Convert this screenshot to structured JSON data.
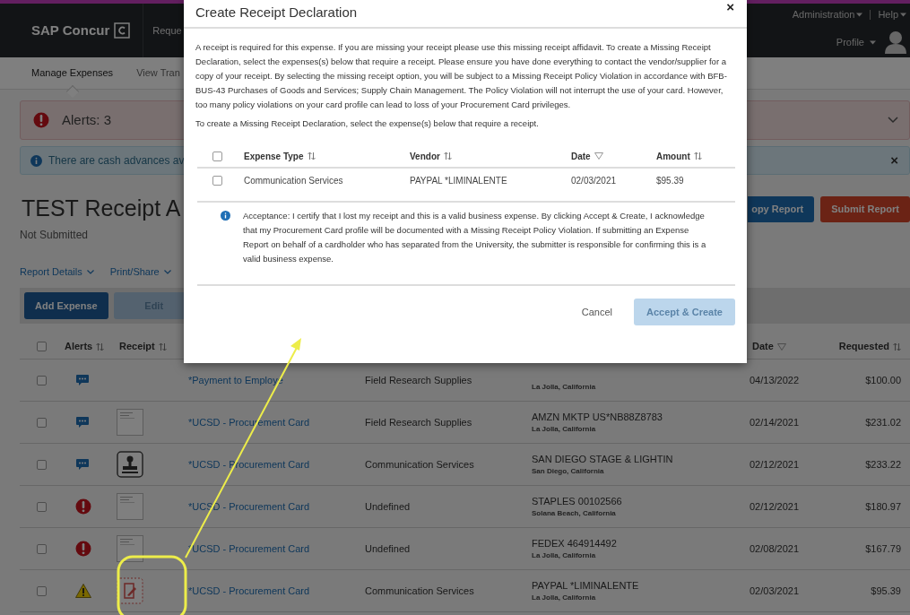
{
  "app_header": {
    "logo": "SAP Concur",
    "nav_items": [
      "Reque"
    ],
    "admin_menu": "Administration",
    "help_menu": "Help",
    "profile_menu": "Profile"
  },
  "subnav": [
    {
      "label": "Manage Expenses",
      "selected": true
    },
    {
      "label": "View Tran",
      "selected": false
    }
  ],
  "alerts_banner": {
    "text": "Alerts: 3"
  },
  "info_banner": {
    "text": "There are cash advances av",
    "close": "×"
  },
  "report": {
    "title": "TEST Receipt A",
    "status": "Not Submitted",
    "menus": [
      "Report Details",
      "Print/Share"
    ],
    "actions": [
      {
        "label": "opy Report",
        "kind": "secondary"
      },
      {
        "label": "Submit Report",
        "kind": "primary"
      }
    ]
  },
  "toolbar": [
    {
      "label": "Add Expense",
      "disabled": false
    },
    {
      "label": "Edit",
      "disabled": true
    }
  ],
  "table": {
    "header_checked": false,
    "columns": [
      {
        "label": "Alerts",
        "kind": "sortable"
      },
      {
        "label": "Receipt",
        "kind": "sortable"
      },
      {
        "label": "Date",
        "kind": "filter"
      },
      {
        "label": "Requested",
        "kind": "sortable"
      }
    ],
    "rows": [
      {
        "checked": false,
        "alert": {
          "kind": "comment"
        },
        "payment_type": "*Payment to Employe",
        "expense_type": "Field Research Supplies",
        "location": "La Jolla, California",
        "date": "04/13/2022",
        "requested": "$100.00"
      },
      {
        "checked": false,
        "alert": {
          "kind": "comment"
        },
        "receipt": {
          "kind": "image"
        },
        "payment_type": "*UCSD - Procurement Card",
        "expense_type": "Field Research Supplies",
        "vendor": "AMZN MKTP US*NB88Z8783",
        "location": "La Jolla, California",
        "date": "02/14/2021",
        "requested": "$231.02"
      },
      {
        "checked": false,
        "alert": {
          "kind": "comment"
        },
        "receipt": {
          "kind": "stamp"
        },
        "payment_type": "*UCSD - Procurement Card",
        "expense_type": "Communication Services",
        "vendor": "SAN DIEGO STAGE & LIGHTIN",
        "location": "San Diego, California",
        "date": "02/12/2021",
        "requested": "$233.22"
      },
      {
        "checked": false,
        "alert": {
          "kind": "error"
        },
        "receipt": {
          "kind": "image"
        },
        "payment_type": "*UCSD - Procurement Card",
        "expense_type": "Undefined",
        "vendor": "STAPLES 00102566",
        "location": "Solana Beach, California",
        "date": "02/12/2021",
        "requested": "$180.97"
      },
      {
        "checked": false,
        "alert": {
          "kind": "error"
        },
        "receipt": {
          "kind": "image"
        },
        "payment_type": "*UCSD - Procurement Card",
        "expense_type": "Undefined",
        "vendor": "FEDEX 464914492",
        "location": "La Jolla, California",
        "date": "02/08/2021",
        "requested": "$167.79"
      },
      {
        "checked": false,
        "alert": {
          "kind": "warning"
        },
        "receipt": {
          "kind": "missing"
        },
        "payment_type": "*UCSD - Procurement Card",
        "expense_type": "Communication Services",
        "vendor": "PAYPAL *LIMINALENTE",
        "location": "La Jolla, California",
        "date": "02/03/2021",
        "requested": "$95.39"
      }
    ]
  },
  "dialog": {
    "title": "Create Receipt Declaration",
    "close": "×",
    "intro": "A receipt is required for this expense. If you are missing your receipt please use this missing receipt affidavit. To create a Missing Receipt Declaration, select the expenses(s) below that require a receipt. Please ensure you have done everything to contact the vendor/supplier for a copy of your receipt. By selecting the missing receipt option, you will be subject to a Missing Receipt Policy Violation in accordance with BFB-BUS-43 Purchases of Goods and Services; Supply Chain Management. The Policy Violation will not interrupt the use of your card. However, too many policy violations on your card profile can lead to loss of your Procurement Card privileges.",
    "instruction": "To create a Missing Receipt Declaration, select the expense(s) below that require a receipt.",
    "header_checked": false,
    "columns": [
      {
        "label": "Expense Type",
        "kind": "sortable"
      },
      {
        "label": "Vendor",
        "kind": "sortable"
      },
      {
        "label": "Date",
        "kind": "filter"
      },
      {
        "label": "Amount",
        "kind": "sortable"
      }
    ],
    "rows": [
      {
        "checked": false,
        "cells": [
          "Communication Services",
          "PAYPAL *LIMINALENTE",
          "02/03/2021",
          "$95.39"
        ]
      }
    ],
    "acceptance": "Acceptance: I certify that I lost my receipt and this is a valid business expense. By clicking Accept & Create, I acknowledge that my Procurement Card profile will be documented with a Missing Receipt Policy Violation. If submitting an Expense Report on behalf of a cardholder who has separated from the University, the submitter is responsible for confirming this is a valid business expense.",
    "buttons": [
      {
        "label": "Cancel",
        "kind": "link",
        "disabled": false
      },
      {
        "label": "Accept & Create",
        "kind": "primary",
        "disabled": true
      }
    ]
  }
}
